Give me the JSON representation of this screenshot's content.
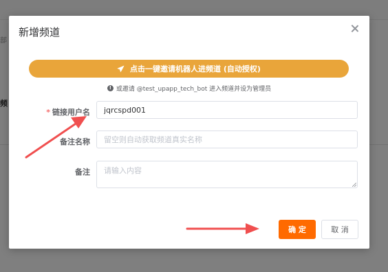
{
  "background": {
    "side_text_1": "部",
    "side_text_2": "频"
  },
  "dialog": {
    "title": "新增频道",
    "invite_button_label": "点击一键邀请机器人进频道 (自动授权)",
    "tip_text": "或邀请 @test_upapp_tech_bot 进入频道并设为管理员",
    "fields": {
      "username": {
        "required_mark": "*",
        "label": "链接用户名",
        "value": "jqrcspd001"
      },
      "remark_name": {
        "label": "备注名称",
        "placeholder": "留空则自动获取频道真实名称"
      },
      "remark": {
        "label": "备注",
        "placeholder": "请输入内容"
      }
    },
    "confirm_label": "确 定",
    "cancel_label": "取 消"
  },
  "colors": {
    "invite_button": "#e9a53a",
    "confirm_button": "#ff6a00",
    "annotation_arrow": "#f04f4f",
    "required_mark": "#f56c6c"
  },
  "icons": {
    "close": "close-icon",
    "send": "send-icon",
    "info": "info-icon"
  }
}
